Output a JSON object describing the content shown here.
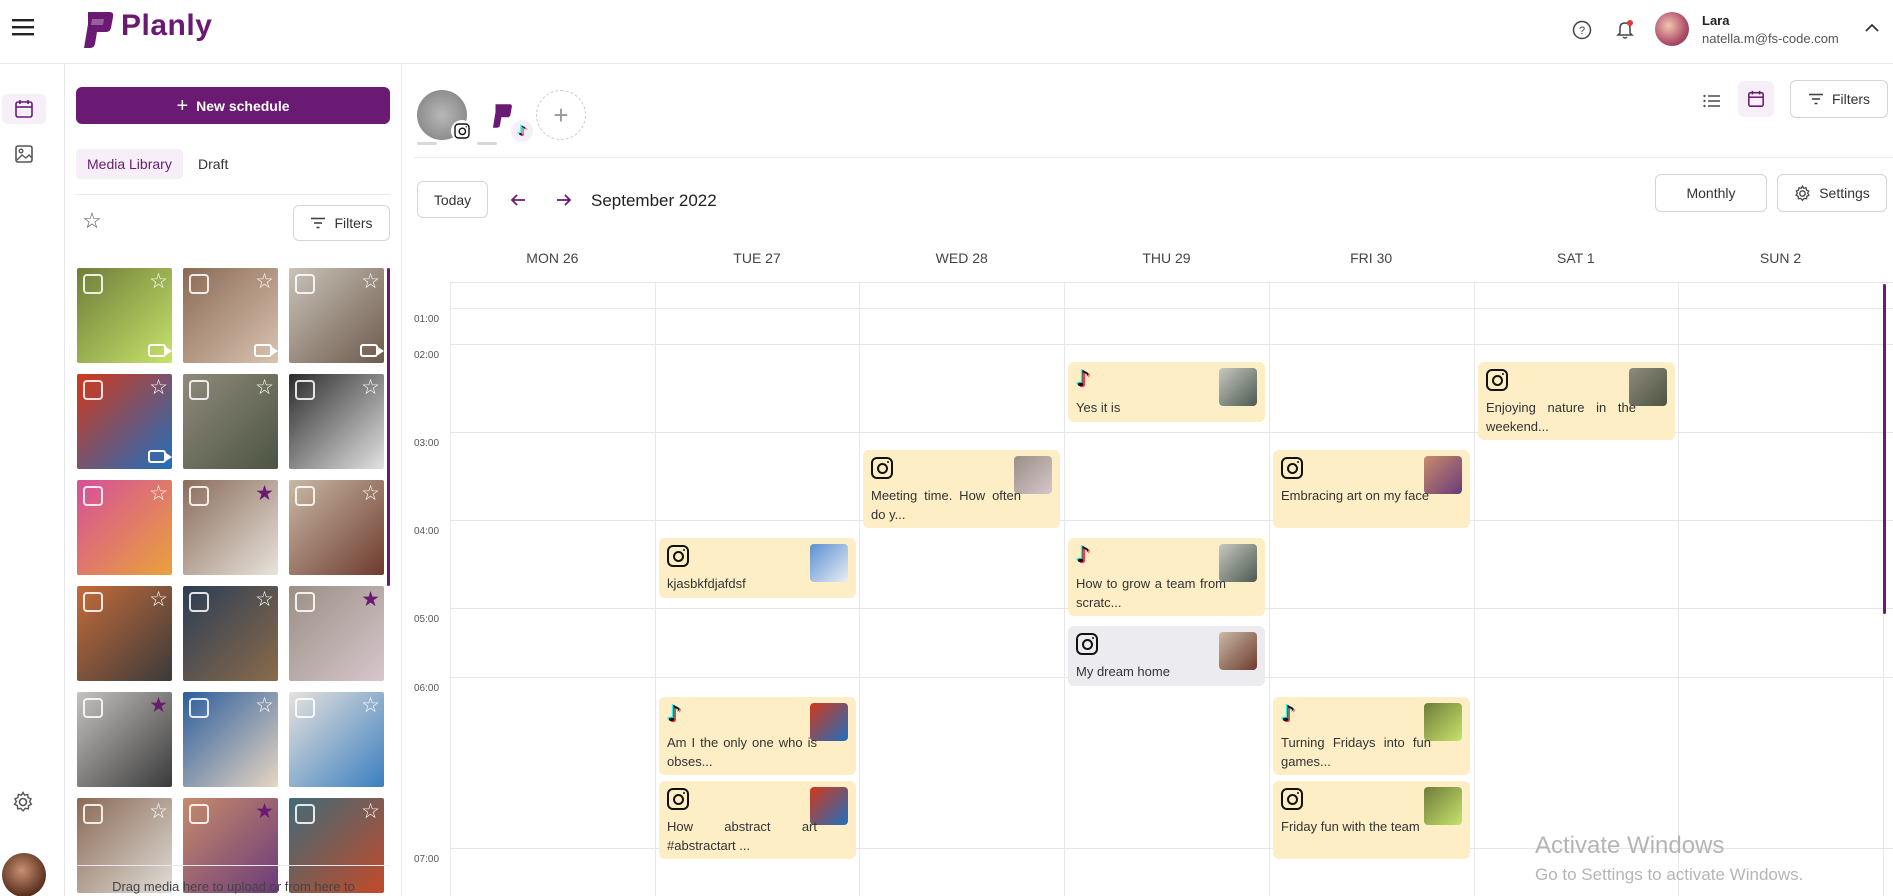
{
  "app": {
    "name": "Planly"
  },
  "user": {
    "name": "Lara",
    "email": "natella.m@fs-code.com"
  },
  "left_panel": {
    "new_schedule_label": "New schedule",
    "tabs": [
      {
        "label": "Media Library",
        "active": true
      },
      {
        "label": "Draft",
        "active": false
      }
    ],
    "filters_label": "Filters",
    "drop_hint": "Drag media here to upload or from here to",
    "media": [
      {
        "colors": [
          "#6f7d3a",
          "#c7e36b"
        ],
        "fav": false,
        "video": true
      },
      {
        "colors": [
          "#8a6a55",
          "#d9c4b0"
        ],
        "fav": false,
        "video": true
      },
      {
        "colors": [
          "#c9c3b8",
          "#6d5a4c"
        ],
        "fav": false,
        "video": true
      },
      {
        "colors": [
          "#d2381a",
          "#1f6fbf"
        ],
        "fav": false,
        "video": true
      },
      {
        "colors": [
          "#8f8a7c",
          "#4c5442"
        ],
        "fav": false,
        "video": false
      },
      {
        "colors": [
          "#2b2b2b",
          "#e3e3e3"
        ],
        "fav": false,
        "video": false
      },
      {
        "colors": [
          "#d64f9a",
          "#e9a33a"
        ],
        "fav": false,
        "video": false
      },
      {
        "colors": [
          "#8a6d5a",
          "#e8e2dc"
        ],
        "fav": true,
        "video": false
      },
      {
        "colors": [
          "#c9b9a5",
          "#6e3b2e"
        ],
        "fav": false,
        "video": false
      },
      {
        "colors": [
          "#c46b3a",
          "#3a3a3a"
        ],
        "fav": false,
        "video": false
      },
      {
        "colors": [
          "#2c3d55",
          "#8a6b4a"
        ],
        "fav": false,
        "video": false
      },
      {
        "colors": [
          "#9a8f85",
          "#d7c6cc"
        ],
        "fav": true,
        "video": false
      },
      {
        "colors": [
          "#c5c2c0",
          "#3a3a3a"
        ],
        "fav": true,
        "video": false
      },
      {
        "colors": [
          "#2b5d9c",
          "#e7d6c2"
        ],
        "fav": false,
        "video": false
      },
      {
        "colors": [
          "#e6e2dd",
          "#3b7fbf"
        ],
        "fav": false,
        "video": false
      },
      {
        "colors": [
          "#8a6a55",
          "#e0ddd8"
        ],
        "fav": false,
        "video": false
      },
      {
        "colors": [
          "#c78b6a",
          "#6b3b7a"
        ],
        "fav": true,
        "video": false
      },
      {
        "colors": [
          "#3f6b78",
          "#c24a2a"
        ],
        "fav": false,
        "video": false
      }
    ]
  },
  "toolbar": {
    "today_label": "Today",
    "month_label": "September 2022",
    "view_label": "Monthly",
    "settings_label": "Settings",
    "filters_label": "Filters"
  },
  "calendar": {
    "days": [
      "MON 26",
      "TUE 27",
      "WED 28",
      "THU 29",
      "FRI 30",
      "SAT 1",
      "SUN 2"
    ],
    "hours": [
      "01:00",
      "02:00",
      "03:00",
      "04:00",
      "05:00",
      "06:00",
      "07:00"
    ],
    "events": [
      {
        "day": 3,
        "platform": "tiktok",
        "text": "Yes it is",
        "style": "yellow",
        "thumb": [
          "#c8c8c0",
          "#4a5a50"
        ]
      },
      {
        "day": 5,
        "platform": "instagram",
        "text": "Enjoying nature in the weekend...",
        "style": "yellow",
        "thumb": [
          "#8f8a7c",
          "#4c5442"
        ]
      },
      {
        "day": 2,
        "platform": "instagram",
        "text": "Meeting time. How often do y...",
        "style": "yellow",
        "thumb": [
          "#9a8f85",
          "#d7c6cc"
        ]
      },
      {
        "day": 4,
        "platform": "instagram",
        "text": "Embracing art on my face",
        "style": "yellow",
        "thumb": [
          "#c78b6a",
          "#6b3b7a"
        ]
      },
      {
        "day": 1,
        "platform": "instagram",
        "text": "kjasbkfdjafdsf",
        "style": "yellow",
        "thumb": [
          "#5b8fd0",
          "#e9eef5"
        ]
      },
      {
        "day": 3,
        "platform": "tiktok",
        "text": "How to grow a team from scratc...",
        "style": "yellow",
        "thumb": [
          "#c8c8c0",
          "#4a5a50"
        ]
      },
      {
        "day": 3,
        "platform": "instagram",
        "text": "My dream home",
        "style": "gray",
        "thumb": [
          "#c9b9a5",
          "#6e3b2e"
        ]
      },
      {
        "day": 1,
        "platform": "tiktok",
        "text": "Am I the only one who is obses...",
        "style": "yellow",
        "thumb": [
          "#d2381a",
          "#1f6fbf"
        ]
      },
      {
        "day": 4,
        "platform": "tiktok",
        "text": "Turning Fridays into fun games...",
        "style": "yellow",
        "thumb": [
          "#6f7d3a",
          "#c7e36b"
        ]
      },
      {
        "day": 1,
        "platform": "instagram",
        "text": "How abstract art #abstractart ...",
        "style": "yellow",
        "thumb": [
          "#d2381a",
          "#1f6fbf"
        ]
      },
      {
        "day": 4,
        "platform": "instagram",
        "text": "Friday fun with the team",
        "style": "yellow",
        "thumb": [
          "#6f7d3a",
          "#c7e36b"
        ]
      }
    ]
  },
  "watermark": {
    "title": "Activate Windows",
    "subtitle": "Go to Settings to activate Windows."
  },
  "colors": {
    "brand": "#6b1a73",
    "event_yellow": "#fdeec6",
    "event_gray": "#ececf0"
  }
}
